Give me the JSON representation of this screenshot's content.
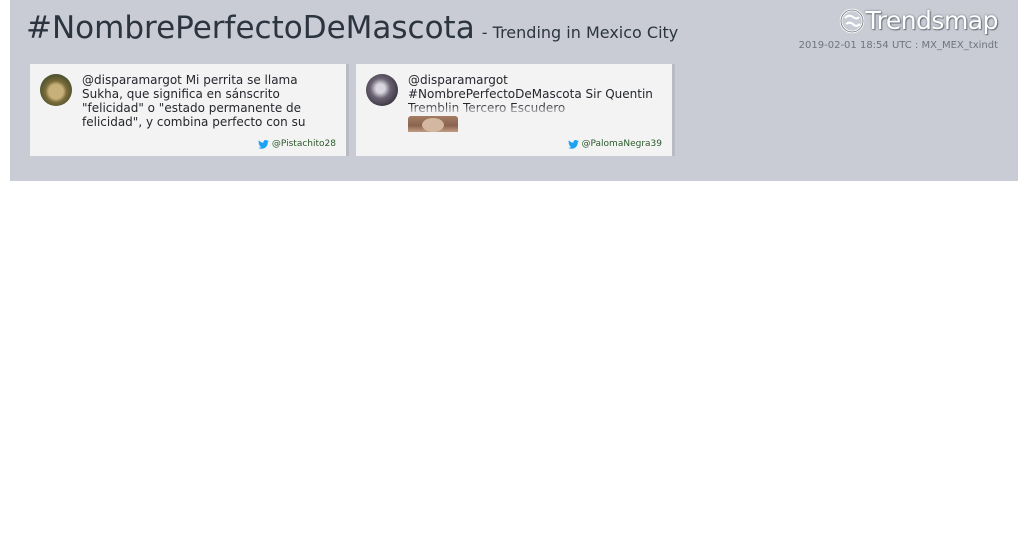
{
  "header": {
    "hashtag": "#NombrePerfectoDeMascota",
    "subtitle": "- Trending in Mexico City",
    "brand": "Trendsmap",
    "timestamp": "2019-02-01 18:54 UTC : MX_MEX_txindt"
  },
  "tweets": [
    {
      "text": "@disparamargot Mi perrita se llama Sukha, que significa en sánscrito \"felicidad\" o \"estado permanente de felicidad\", y combina perfecto con su personalidad",
      "author": "@Pistachito28",
      "avatar_icon": "user-avatar"
    },
    {
      "text": "@disparamargot #NombrePerfectoDeMascota Sir Quentin Tremblin Tercero Escudero",
      "author": "@PalomaNegra39",
      "avatar_icon": "user-avatar"
    }
  ],
  "colors": {
    "panel": "#c9ccd4",
    "card": "#f3f3f4",
    "twitter_blue": "#1da1f2",
    "handle": "#2b5a2b"
  }
}
